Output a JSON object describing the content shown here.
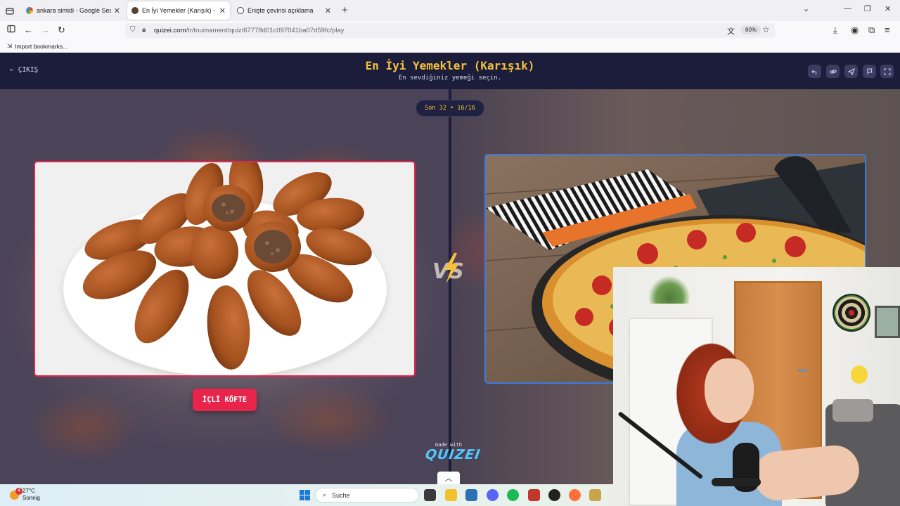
{
  "browser": {
    "tabs": [
      {
        "title": "ankara simidi - Google Search",
        "active": false,
        "favicon_color": "#4285f4"
      },
      {
        "title": "En İyi Yemekler (Karışık) - Quizei",
        "active": true,
        "favicon_color": "#5a3e2b"
      },
      {
        "title": "Enişte çevirisi açıklama",
        "active": false,
        "favicon_color": "#444444"
      }
    ],
    "url_host": "quizei.com",
    "url_path": "/tr/tournament/quiz/67778d01c097041ba07d59fc/play",
    "zoom": "80%",
    "bookmark": "Import bookmarks..."
  },
  "quiz": {
    "exit_label": "ÇIKIŞ",
    "title": "En İyi Yemekler (Karışık)",
    "subtitle": "En sevdiğiniz yemeği seçin.",
    "round": "Son 32 • 16/16",
    "left_choice_label": "İÇLİ KÖFTE",
    "made_with": "made with",
    "brand": "QUIZEI",
    "colors": {
      "accent": "#f5c13c",
      "left_border": "#e8244a",
      "right_border": "#3a7be0",
      "header_bg": "#1c1d3a"
    }
  },
  "taskbar": {
    "temperature": "27°C",
    "weather": "Sonnig",
    "weather_badge": "4",
    "search_placeholder": "Suche"
  }
}
